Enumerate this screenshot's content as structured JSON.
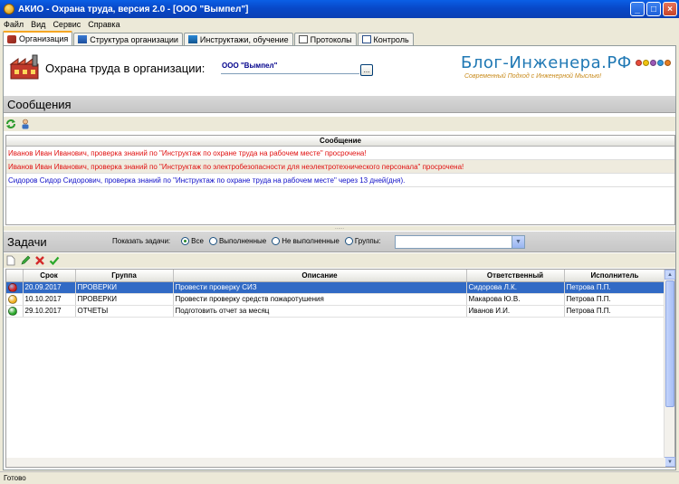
{
  "window": {
    "title": "АКИО - Охрана труда, версия 2.0 - [ООО \"Вымпел\"]"
  },
  "menu": [
    "Файл",
    "Вид",
    "Сервис",
    "Справка"
  ],
  "tabs": [
    {
      "label": "Организация",
      "active": true
    },
    {
      "label": "Структура организации"
    },
    {
      "label": "Инструктажи, обучение"
    },
    {
      "label": "Протоколы"
    },
    {
      "label": "Контроль"
    }
  ],
  "header": {
    "label": "Охрана труда в организации:",
    "org_value": "ООО \"Вымпел\"",
    "browse_label": "...",
    "logo_main": "Блог-Инженера.РФ",
    "logo_sub": "Современный Подход с Инженерной Мыслью!"
  },
  "messages": {
    "title": "Сообщения",
    "column": "Сообщение",
    "rows": [
      {
        "text": "Иванов Иван Иванович, проверка знаний по \"Инструктаж по охране труда на рабочем месте\"  просрочена!",
        "color": "#e01010",
        "bg": "#ffffff"
      },
      {
        "text": "Иванов Иван Иванович, проверка знаний по \"Инструктаж по электробезопасности для неэлектротехнического персонала\"  просрочена!",
        "color": "#e01010",
        "bg": "#efebde"
      },
      {
        "text": "Сидоров Сидор Сидорович, проверка знаний по \"Инструктаж по охране труда на рабочем месте\" через 13 дней(дня).",
        "color": "#1010c8",
        "bg": "#ffffff"
      }
    ]
  },
  "tasks": {
    "title": "Задачи",
    "filter_label": "Показать задачи:",
    "filters": [
      {
        "label": "Все",
        "checked": true
      },
      {
        "label": "Выполненные"
      },
      {
        "label": "Не выполненные"
      },
      {
        "label": "Группы:"
      }
    ],
    "group_value": "",
    "columns": [
      "",
      "Срок",
      "Группа",
      "Описание",
      "Ответственный",
      "Исполнитель"
    ],
    "rows": [
      {
        "status": "#d42020",
        "date": "20.09.2017",
        "group": "ПРОВЕРКИ",
        "desc": "Провести проверку СИЗ",
        "resp": "Сидорова Л.К.",
        "exec": "Петрова П.П.",
        "selected": true
      },
      {
        "status": "#f0b020",
        "date": "10.10.2017",
        "group": "ПРОВЕРКИ",
        "desc": "Провести проверку средств пожаротушения",
        "resp": "Макарова Ю.В.",
        "exec": "Петрова П.П.",
        "alt": true
      },
      {
        "status": "#2aa82a",
        "date": "29.10.2017",
        "group": "ОТЧЕТЫ",
        "desc": "Подготовить отчет за месяц",
        "resp": "Иванов И.И.",
        "exec": "Петрова П.П."
      }
    ]
  },
  "status": {
    "text": "Готово"
  },
  "colors": {
    "accent": "#316ac5",
    "tab_highlight": "#f5a623"
  }
}
